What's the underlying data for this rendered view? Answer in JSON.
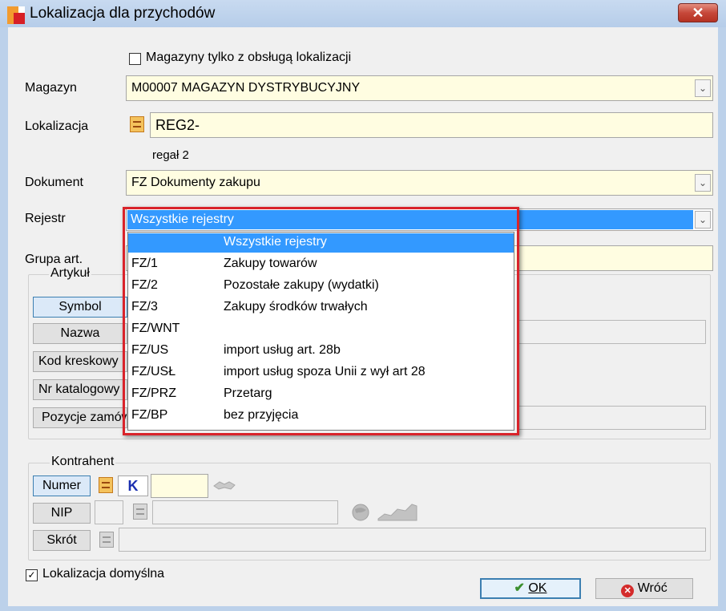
{
  "window": {
    "title": "Lokalizacja dla przychodów",
    "close_label": "✕"
  },
  "filter": {
    "warehouses_only_label": "Magazyny tylko z obsługą lokalizacji",
    "warehouses_only_checked": false
  },
  "magazyn": {
    "label": "Magazyn",
    "value": "M00007 MAGAZYN DYSTRYBUCYJNY"
  },
  "lokalizacja": {
    "label": "Lokalizacja",
    "value": "REG2-",
    "description": "regał 2"
  },
  "dokument": {
    "label": "Dokument",
    "value": "FZ Dokumenty zakupu"
  },
  "rejestr": {
    "label": "Rejestr",
    "value": "Wszystkie rejestry",
    "options": [
      {
        "code": "",
        "desc": "Wszystkie rejestry",
        "selected": true
      },
      {
        "code": "FZ/1",
        "desc": "Zakupy towarów",
        "selected": false
      },
      {
        "code": "FZ/2",
        "desc": "Pozostałe zakupy (wydatki)",
        "selected": false
      },
      {
        "code": "FZ/3",
        "desc": "Zakupy środków trwałych",
        "selected": false
      },
      {
        "code": "FZ/WNT",
        "desc": "",
        "selected": false
      },
      {
        "code": "FZ/US",
        "desc": "import usług art. 28b",
        "selected": false
      },
      {
        "code": "FZ/USŁ",
        "desc": "import usług spoza Unii z wył art 28",
        "selected": false
      },
      {
        "code": "FZ/PRZ",
        "desc": "Przetarg",
        "selected": false
      },
      {
        "code": "FZ/BP",
        "desc": "bez przyjęcia",
        "selected": false
      }
    ]
  },
  "grupa": {
    "label": "Grupa art."
  },
  "artykul": {
    "group_label": "Artykuł",
    "buttons": [
      "Symbol",
      "Nazwa",
      "Kod kreskowy",
      "Nr katalogowy",
      "Pozycje zamówienia"
    ]
  },
  "kontrahent": {
    "group_label": "Kontrahent",
    "numer_label": "Numer",
    "k_label": "K",
    "nip_label": "NIP",
    "skrot_label": "Skrót"
  },
  "default_location": {
    "label": "Lokalizacja domyślna",
    "checked": true
  },
  "actions": {
    "ok_label": "OK",
    "back_label": "Wróć"
  },
  "colors": {
    "field_bg": "#fffde1",
    "selection": "#3399ff",
    "highlight_border": "#d9232a"
  }
}
